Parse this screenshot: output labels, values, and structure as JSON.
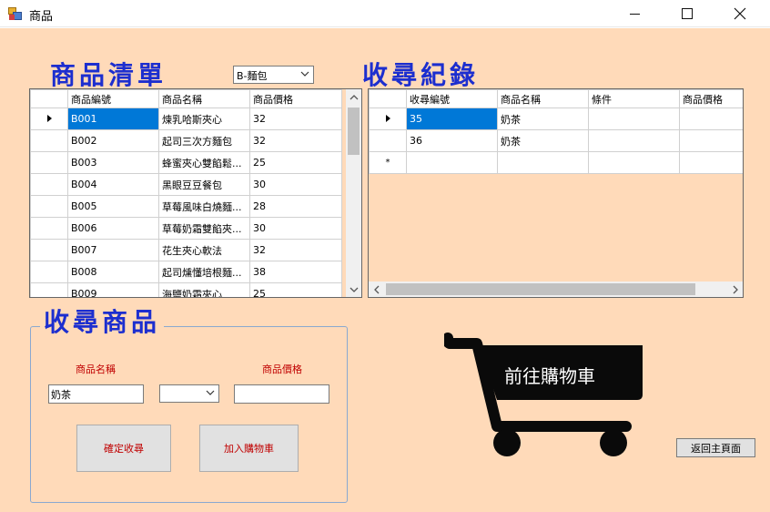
{
  "window": {
    "title": "商品"
  },
  "product_list": {
    "title": "商品清單",
    "category": {
      "value": "B-麵包"
    },
    "columns": [
      "商品編號",
      "商品名稱",
      "商品價格"
    ],
    "rows": [
      [
        "B001",
        "煉乳哈斯夾心",
        "32"
      ],
      [
        "B002",
        "起司三次方麵包",
        "32"
      ],
      [
        "B003",
        "蜂蜜夾心雙餡鬆...",
        "25"
      ],
      [
        "B004",
        "黑眼豆豆餐包",
        "30"
      ],
      [
        "B005",
        "草莓風味白燒麵...",
        "28"
      ],
      [
        "B006",
        "草莓奶霜雙餡夾...",
        "30"
      ],
      [
        "B007",
        "花生夾心軟法",
        "32"
      ],
      [
        "B008",
        "起司燻懂培根麵...",
        "38"
      ],
      [
        "B009",
        "海鹽奶霜夾心",
        "25"
      ]
    ]
  },
  "favorites": {
    "title": "收尋紀錄",
    "columns": [
      "收尋編號",
      "商品名稱",
      "條件",
      "商品價格"
    ],
    "rows": [
      [
        "35",
        "奶茶",
        "",
        ""
      ],
      [
        "36",
        "奶茶",
        "",
        ""
      ]
    ],
    "new_row_marker": "*"
  },
  "search": {
    "title": "收尋商品",
    "name_label": "商品名稱",
    "price_label": "商品價格",
    "name_value": "奶茶",
    "condition_value": "",
    "price_value": "",
    "confirm_label": "確定收尋",
    "add_cart_label": "加入購物車"
  },
  "cart": {
    "label": "前往購物車"
  },
  "back_label": "返回主頁面"
}
